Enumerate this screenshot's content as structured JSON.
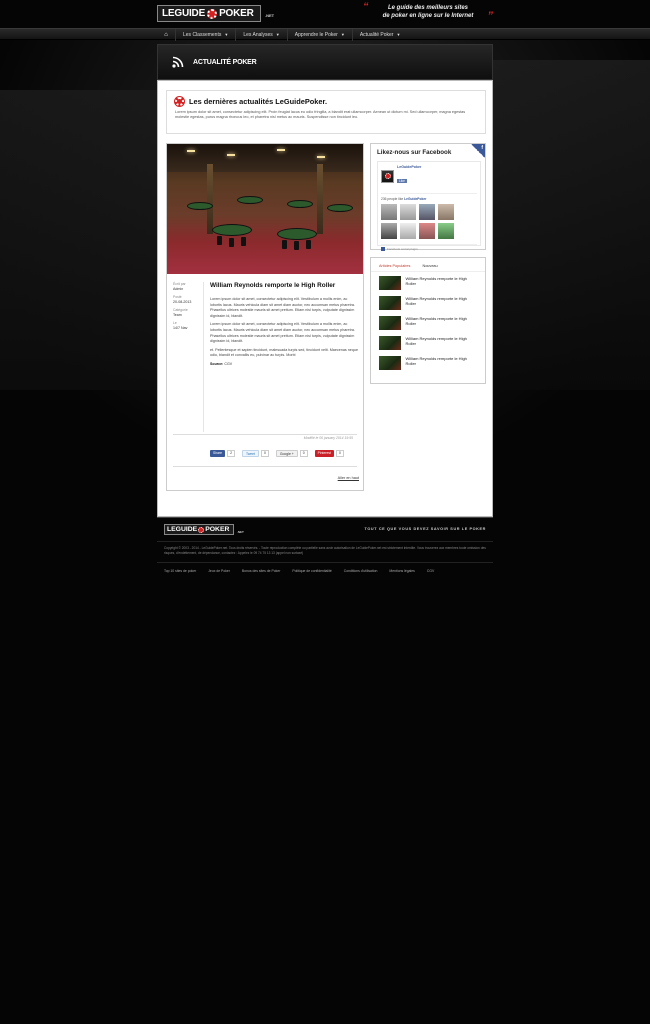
{
  "header": {
    "logo_left": "LEGUIDE",
    "logo_right": "POKER",
    "logo_suffix": ".NET",
    "tagline_line1": "Le guide des meilleurs sites",
    "tagline_line2": "de poker en ligne sur le Internet"
  },
  "nav": {
    "items": [
      {
        "label": "Les Classements"
      },
      {
        "label": "Les Analyses"
      },
      {
        "label": "Apprendre le Poker"
      },
      {
        "label": "Actualité Poker"
      }
    ]
  },
  "page_title": "ACTUALITÉ POKER",
  "intro": {
    "heading": "Les dernières actualités LeGuidePoker.",
    "text": "Lorem ipsum dolor sit amet, consectetur adipiscing elit. Proin feugiat lacus eu odio fringilla, a blandit erat ullamcorper. Aenean ut dictum mi. Sed ullamcorper, magna egestas molestie egestas, purus magna rhoncus leo, et pharetra nisl metus ac mauris. Suspendisse non tincidunt leo."
  },
  "article": {
    "meta": {
      "written_by_label": "Écrit par",
      "author": "Admin",
      "posted_label": "Posté",
      "date": "20-08-2013",
      "category_label": "Catégorie",
      "category": "Team",
      "le_label": "Le",
      "le_value": "14/7 Nav"
    },
    "title": "William Reynolds remporte le High Roller",
    "paragraphs": [
      "Lorem ipsum dolor sit amet, consectetur adipiscing elit. Vestibulum a mollis enim, ac lobortis lacus. Mauris vehicula diam sit amet diam auctor, nec accumsan metus pharetra. Phasellus ultrices molestie mauris sit amet pretium. Etiam nisl turpis, vulputate dignissim dignissim id, blandit.",
      "Lorem ipsum dolor sit amet, consectetur adipiscing elit. Vestibulum a mollis enim, ac lobortis lacus. Mauris vehicula diam sit amet diam auctor, nec accumsan metus pharetra. Phasellus ultrices molestie mauris sit amet pretium. Etiam nisl turpis, vulputate dignissim dignissim id, blandit.",
      "et. Pellentesque et sapien tincidunt, malesuada turpis sed, tincidunt velit. Maecenas neque odio, blandit et convallis eu, pulvinar ac turpis. Morbi"
    ],
    "source_label": "Source:",
    "source_value": "CGV",
    "modified": "Modifié le 06 january 2014 19:55",
    "share": {
      "facebook": "Share",
      "facebook_count": "2",
      "twitter": "Tweet",
      "twitter_count": "0",
      "google": "Google +",
      "google_count": "0",
      "pinterest": "Pinterest",
      "pinterest_count": "0"
    },
    "back_to_top": "Aller en haut"
  },
  "facebook": {
    "heading": "Likez-nous sur Facebook",
    "page_name": "LeGuidePoker",
    "like_label": "Like",
    "count_text": "236 people like",
    "count_name": "LeGuidePoker",
    "plugin_text": "Facebook social plugin"
  },
  "popular": {
    "tabs": [
      "Articles Populaires",
      "Nouveau"
    ],
    "items": [
      {
        "title": "William Reynolds remporte le High Roller"
      },
      {
        "title": "William Reynolds remporte le High Roller"
      },
      {
        "title": "William Reynolds remporte le High Roller"
      },
      {
        "title": "William Reynolds remporte le High Roller"
      },
      {
        "title": "William Reynolds remporte le High Roller"
      }
    ]
  },
  "footer": {
    "logo_left": "LEGUIDE",
    "logo_right": "POKER",
    "logo_suffix": ".NET",
    "tagline": "TOUT CE QUE VOUS DEVEZ SAVOIR SUR LE POKER",
    "copyright": "Copyright © 2003 - 2014 - LeGuidePoker.net. Tous droits réservés. - Toute reproduction complète ou partielle sans avoir autorisation de LeGuidePoker.net est strictement interdite. Vous trouverez aux membres toute omission des risques, d'endettement, de dépendance, contactez : Appelez le 09 74 75 13 13 (appel non surtaxé)",
    "links": [
      "Top 10 sites de poker",
      "Jeux de Poker",
      "Bonus des sites de Poker",
      "Politique de confidentialité",
      "Conditions d'utilisation",
      "Mentions légales",
      "CGV"
    ]
  },
  "colors": {
    "accent": "#d42222",
    "facebook": "#3b5998",
    "background": "#050505"
  }
}
